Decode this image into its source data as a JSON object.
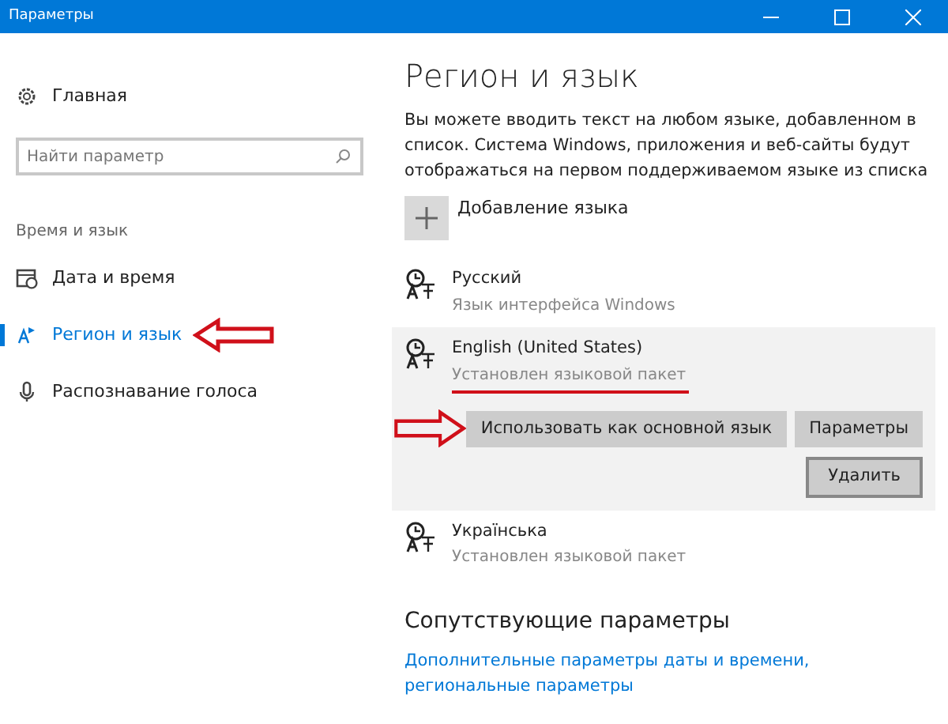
{
  "window": {
    "title": "Параметры"
  },
  "sidebar": {
    "home": "Главная",
    "search": {
      "placeholder": "Найти параметр"
    },
    "section": "Время и язык",
    "items": [
      {
        "label": "Дата и время",
        "kind": "calendar",
        "selected": false
      },
      {
        "label": "Регион и язык",
        "kind": "region",
        "selected": true
      },
      {
        "label": "Распознавание голоса",
        "kind": "mic",
        "selected": false
      }
    ]
  },
  "main": {
    "title": "Регион и язык",
    "description": "Вы можете вводить текст на любом языке, добавленном в список. Система Windows, приложения и веб-сайты будут отображаться на первом поддерживаемом языке из списка",
    "add_language": "Добавление языка",
    "languages": [
      {
        "name": "Русский",
        "status": "Язык интерфейса Windows",
        "selected": false
      },
      {
        "name": "English (United States)",
        "status": "Установлен языковой пакет",
        "selected": true,
        "actions": [
          "Использовать как основной язык",
          "Параметры"
        ],
        "remove": "Удалить"
      },
      {
        "name": "Українська",
        "status": "Установлен языковой пакет",
        "selected": false
      }
    ],
    "related": {
      "title": "Сопутствующие параметры",
      "link": "Дополнительные параметры даты и времени, региональные параметры"
    }
  }
}
